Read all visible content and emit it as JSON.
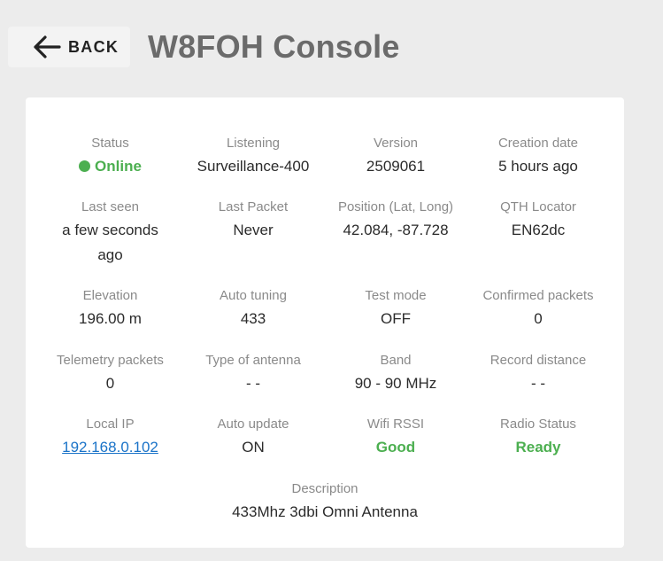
{
  "header": {
    "back_label": "BACK",
    "title": "W8FOH Console"
  },
  "details": {
    "status": {
      "label": "Status",
      "value": "Online"
    },
    "listening": {
      "label": "Listening",
      "value": "Surveillance-400"
    },
    "version": {
      "label": "Version",
      "value": "2509061"
    },
    "creation_date": {
      "label": "Creation date",
      "value": "5 hours ago"
    },
    "last_seen": {
      "label": "Last seen",
      "value": "a few seconds ago"
    },
    "last_packet": {
      "label": "Last Packet",
      "value": "Never"
    },
    "position": {
      "label": "Position (Lat, Long)",
      "value": "42.084, -87.728"
    },
    "qth_locator": {
      "label": "QTH Locator",
      "value": "EN62dc"
    },
    "elevation": {
      "label": "Elevation",
      "value": "196.00 m"
    },
    "auto_tuning": {
      "label": "Auto tuning",
      "value": "433"
    },
    "test_mode": {
      "label": "Test mode",
      "value": "OFF"
    },
    "confirmed_packets": {
      "label": "Confirmed packets",
      "value": "0"
    },
    "telemetry_packets": {
      "label": "Telemetry packets",
      "value": "0"
    },
    "antenna_type": {
      "label": "Type of antenna",
      "value": "- -"
    },
    "band": {
      "label": "Band",
      "value": "90 - 90 MHz"
    },
    "record_distance": {
      "label": "Record distance",
      "value": "- -"
    },
    "local_ip": {
      "label": "Local IP",
      "value": "192.168.0.102"
    },
    "auto_update": {
      "label": "Auto update",
      "value": "ON"
    },
    "wifi_rssi": {
      "label": "Wifi RSSI",
      "value": "Good"
    },
    "radio_status": {
      "label": "Radio Status",
      "value": "Ready"
    },
    "description": {
      "label": "Description",
      "value": "433Mhz 3dbi Omni Antenna"
    }
  },
  "icons": {
    "back": "arrow-left-icon",
    "status": "status-dot-icon"
  },
  "colors": {
    "status_green": "#4caf50",
    "link_blue": "#1a73c8",
    "title_gray": "#6b6b6b",
    "label_gray": "#8a8a8a",
    "background": "#ececec"
  }
}
